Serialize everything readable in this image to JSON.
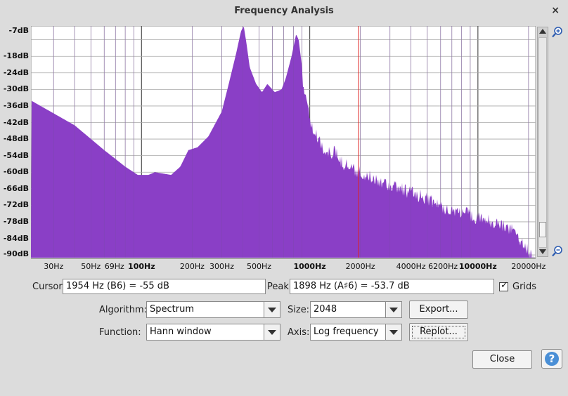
{
  "window": {
    "title": "Frequency Analysis",
    "close_glyph": "×"
  },
  "colors": {
    "spectrum_fill": "#8a3fc6",
    "background": "#dcdcdc",
    "cursor_line": "#e02020",
    "grid": "#a9a9a9",
    "help": "#4a8fd6"
  },
  "chart_data": {
    "type": "area",
    "x_scale": "log",
    "xlim": [
      22,
      22050
    ],
    "ylim": [
      -91,
      -7
    ],
    "ylabel": "",
    "xlabel": "",
    "grid": true,
    "y_tick_labels": [
      "-7dB",
      "-18dB",
      "-24dB",
      "-30dB",
      "-36dB",
      "-42dB",
      "-48dB",
      "-54dB",
      "-60dB",
      "-66dB",
      "-72dB",
      "-78dB",
      "-84dB",
      "-90dB"
    ],
    "x_tick_labels": [
      {
        "text": "30Hz",
        "value": 30,
        "major": false
      },
      {
        "text": "50Hz",
        "value": 50,
        "major": false
      },
      {
        "text": "69Hz",
        "value": 69,
        "major": false
      },
      {
        "text": "100Hz",
        "value": 100,
        "major": true
      },
      {
        "text": "200Hz",
        "value": 200,
        "major": false
      },
      {
        "text": "300Hz",
        "value": 300,
        "major": false
      },
      {
        "text": "500Hz",
        "value": 500,
        "major": false
      },
      {
        "text": "1000Hz",
        "value": 1000,
        "major": true
      },
      {
        "text": "2000Hz",
        "value": 2000,
        "major": false
      },
      {
        "text": "4000Hz",
        "value": 4000,
        "major": false
      },
      {
        "text": "6200Hz",
        "value": 6200,
        "major": false
      },
      {
        "text": "10000Hz",
        "value": 10000,
        "major": true
      },
      {
        "text": "20000Hz",
        "value": 20000,
        "major": false
      }
    ],
    "cursor_hz": 1954,
    "series": [
      {
        "points": [
          [
            22,
            -34
          ],
          [
            40,
            -43
          ],
          [
            60,
            -52
          ],
          [
            80,
            -58
          ],
          [
            95,
            -61
          ],
          [
            110,
            -61
          ],
          [
            120,
            -60
          ],
          [
            150,
            -61
          ],
          [
            170,
            -58
          ],
          [
            190,
            -52
          ],
          [
            215,
            -51
          ],
          [
            250,
            -47
          ],
          [
            300,
            -38
          ],
          [
            330,
            -28
          ],
          [
            365,
            -17
          ],
          [
            390,
            -9
          ],
          [
            405,
            -7
          ],
          [
            420,
            -13
          ],
          [
            440,
            -22
          ],
          [
            480,
            -28
          ],
          [
            520,
            -31
          ],
          [
            560,
            -28
          ],
          [
            620,
            -31
          ],
          [
            680,
            -30
          ],
          [
            720,
            -26
          ],
          [
            780,
            -18
          ],
          [
            830,
            -10
          ],
          [
            860,
            -12
          ],
          [
            900,
            -22
          ],
          [
            960,
            -33
          ],
          [
            1050,
            -43
          ],
          [
            1150,
            -46
          ],
          [
            1250,
            -51
          ],
          [
            1400,
            -50
          ],
          [
            1550,
            -54
          ],
          [
            1800,
            -56
          ],
          [
            2000,
            -58
          ],
          [
            2500,
            -60
          ],
          [
            3000,
            -62
          ],
          [
            4000,
            -65
          ],
          [
            5000,
            -67
          ],
          [
            6000,
            -70
          ],
          [
            8000,
            -72
          ],
          [
            10000,
            -74
          ],
          [
            13000,
            -76
          ],
          [
            16000,
            -78
          ],
          [
            18000,
            -82
          ],
          [
            20000,
            -86
          ],
          [
            22050,
            -91
          ]
        ]
      }
    ]
  },
  "controls": {
    "cursor_label": "Cursor:",
    "cursor_value": "1954 Hz (B6) = -55 dB",
    "peak_label": "Peak:",
    "peak_value": "1898 Hz (A♯6) = -53.7 dB",
    "grids_label": "Grids",
    "grids_checked": true,
    "algorithm_label": "Algorithm:",
    "algorithm_value": "Spectrum",
    "function_label": "Function:",
    "function_value": "Hann window",
    "size_label": "Size:",
    "size_value": "2048",
    "axis_label": "Axis:",
    "axis_value": "Log frequency",
    "export_label": "Export...",
    "replot_label": "Replot...",
    "close_label": "Close",
    "help_glyph": "?"
  }
}
